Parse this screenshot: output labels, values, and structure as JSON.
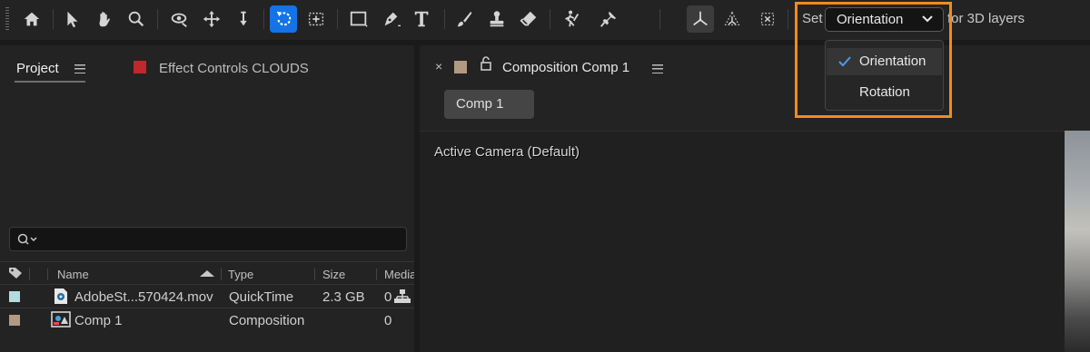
{
  "toolbar": {
    "tools": [
      {
        "icon": "home-icon"
      },
      {
        "icon": "selection-arrow-icon"
      },
      {
        "icon": "hand-icon"
      },
      {
        "icon": "zoom-icon"
      },
      {
        "icon": "orbit-camera-icon"
      },
      {
        "icon": "pan-camera-icon"
      },
      {
        "icon": "dolly-camera-icon"
      },
      {
        "icon": "rotation-tool-icon",
        "active": true
      },
      {
        "icon": "anchor-point-icon"
      },
      {
        "icon": "rectangle-tool-icon"
      },
      {
        "icon": "pen-tool-icon"
      },
      {
        "icon": "type-tool-icon"
      },
      {
        "icon": "brush-tool-icon"
      },
      {
        "icon": "clone-stamp-icon"
      },
      {
        "icon": "eraser-icon"
      },
      {
        "icon": "roto-brush-icon"
      },
      {
        "icon": "puppet-pin-icon"
      },
      {
        "icon": "local-axis-mode-icon"
      },
      {
        "icon": "world-axis-mode-icon"
      },
      {
        "icon": "view-axis-mode-icon"
      }
    ],
    "set_label": "Set",
    "for_3d_label": "for 3D layers",
    "orientation_select": {
      "value": "Orientation",
      "options": [
        "Orientation",
        "Rotation"
      ],
      "selected_index": 0
    },
    "accent_color": "#1473e6",
    "highlight_color": "#f08c1e"
  },
  "left_panel": {
    "project_tab": "Project",
    "effect_tab": "Effect Controls CLOUDS",
    "effect_swatch_color": "#c0282b",
    "search_placeholder": "",
    "columns": [
      "Name",
      "Type",
      "Size",
      "Media"
    ],
    "items": [
      {
        "name": "AdobeSt...570424.mov",
        "type": "QuickTime",
        "size": "2.3 GB",
        "media": "0",
        "label_color": "#b4dcdc",
        "icon": "quicktime-file-icon"
      },
      {
        "name": "Comp 1",
        "type": "Composition",
        "size": "",
        "media": "0",
        "label_color": "#b09a82",
        "icon": "composition-icon"
      }
    ]
  },
  "right_panel": {
    "close_label": "×",
    "comp_swatch_color": "#b09a82",
    "title": "Composition Comp 1",
    "comp_button": "Comp 1",
    "camera_label": "Active Camera (Default)"
  }
}
